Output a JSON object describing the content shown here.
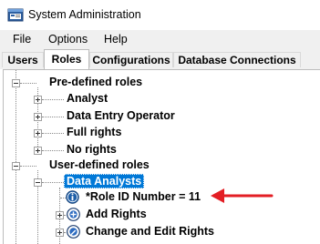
{
  "window": {
    "title": "System Administration",
    "icon": "app-window-icon"
  },
  "menu": [
    "File",
    "Options",
    "Help"
  ],
  "tabs": [
    {
      "label": "Users",
      "active": false
    },
    {
      "label": "Roles",
      "active": true
    },
    {
      "label": "Configurations",
      "active": false
    },
    {
      "label": "Database Connections",
      "active": false
    }
  ],
  "tree": {
    "predefined": {
      "label": "Pre-defined roles",
      "children": [
        "Analyst",
        "Data Entry Operator",
        "Full rights",
        "No rights"
      ]
    },
    "userdefined": {
      "label": "User-defined roles",
      "selected": {
        "label": "Data Analysts",
        "children": [
          {
            "label": "*Role ID Number = 11",
            "icon": "info-icon"
          },
          {
            "label": "Add Rights",
            "icon": "add-rights-icon"
          },
          {
            "label": "Change and Edit Rights",
            "icon": "edit-rights-icon"
          }
        ]
      }
    }
  },
  "colors": {
    "selection": "#0078d7",
    "annotation_arrow": "#e31e24",
    "info_icon": "#1f5fa8"
  }
}
